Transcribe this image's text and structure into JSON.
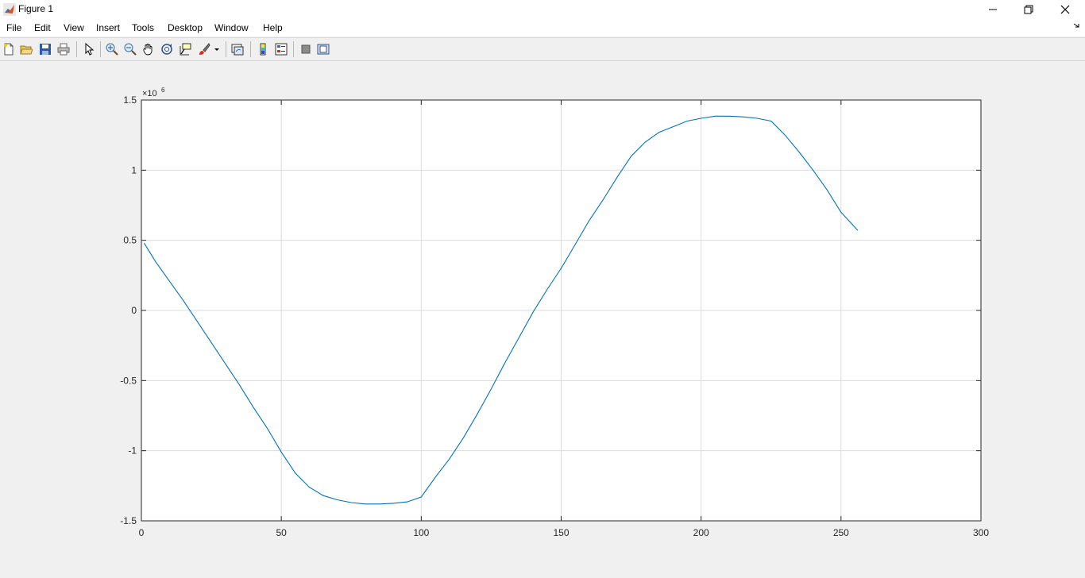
{
  "window": {
    "title": "Figure 1",
    "icon": "matlab-icon",
    "controls": [
      "minimize-icon",
      "restore-icon",
      "close-icon"
    ]
  },
  "menu": {
    "items": [
      "File",
      "Edit",
      "View",
      "Insert",
      "Tools",
      "Desktop",
      "Window",
      "Help"
    ]
  },
  "toolbar": {
    "buttons": [
      "new-figure-icon",
      "open-file-icon",
      "save-icon",
      "print-icon",
      "select-pointer-icon",
      "zoom-in-icon",
      "zoom-out-icon",
      "pan-hand-icon",
      "rotate-3d-icon",
      "data-cursor-icon",
      "brush-icon",
      "link-plot-icon",
      "colorbar-icon",
      "legend-icon",
      "hide-plot-tools-icon",
      "show-plot-tools-icon"
    ]
  },
  "colors": {
    "line": "#0072bd",
    "grid": "#dcdcdc",
    "background": "#f0f0f0"
  },
  "chart_data": {
    "type": "line",
    "title": "",
    "xlabel": "",
    "ylabel": "",
    "xlim": [
      0,
      300
    ],
    "ylim": [
      -1500000,
      1500000
    ],
    "x_ticks": [
      0,
      50,
      100,
      150,
      200,
      250,
      300
    ],
    "x_tick_labels": [
      "0",
      "50",
      "100",
      "150",
      "200",
      "250",
      "300"
    ],
    "y_ticks": [
      -1500000,
      -1000000,
      -500000,
      0,
      500000,
      1000000,
      1500000
    ],
    "y_tick_labels": [
      "-1.5",
      "-1",
      "-0.5",
      "0",
      "0.5",
      "1",
      "1.5"
    ],
    "y_exponent_label": "×10",
    "y_exponent_power": "6",
    "grid": true,
    "series": [
      {
        "x": [
          1,
          5,
          10,
          15,
          20,
          25,
          30,
          35,
          40,
          45,
          50,
          55,
          60,
          65,
          70,
          75,
          80,
          85,
          90,
          95,
          100,
          105,
          110,
          115,
          120,
          125,
          130,
          135,
          140,
          145,
          150,
          155,
          160,
          165,
          170,
          175,
          180,
          185,
          190,
          195,
          200,
          205,
          210,
          215,
          220,
          225,
          230,
          235,
          240,
          245,
          250,
          256
        ],
        "y": [
          480000,
          350000,
          210000,
          70000,
          -80000,
          -230000,
          -380000,
          -530000,
          -690000,
          -840000,
          -1010000,
          -1160000,
          -1260000,
          -1320000,
          -1350000,
          -1370000,
          -1380000,
          -1380000,
          -1375000,
          -1365000,
          -1330000,
          -1190000,
          -1060000,
          -910000,
          -740000,
          -560000,
          -370000,
          -190000,
          -10000,
          150000,
          300000,
          470000,
          640000,
          790000,
          950000,
          1100000,
          1200000,
          1270000,
          1310000,
          1350000,
          1370000,
          1385000,
          1385000,
          1380000,
          1370000,
          1350000,
          1250000,
          1130000,
          1000000,
          860000,
          700000,
          570000
        ]
      }
    ]
  }
}
